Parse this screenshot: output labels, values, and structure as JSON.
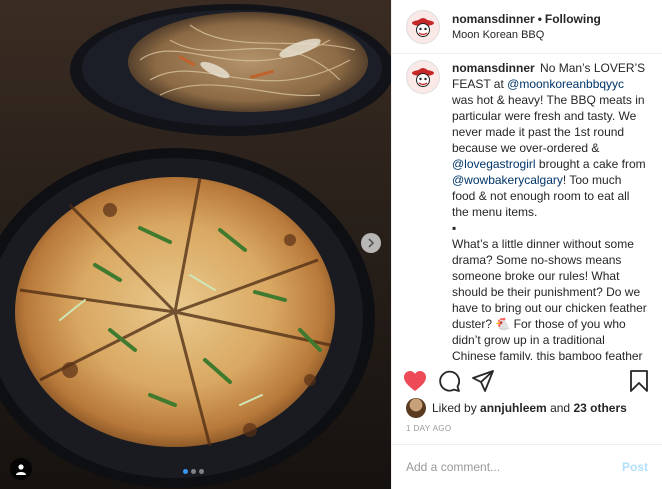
{
  "post": {
    "username": "nomansdinner",
    "separator": "•",
    "follow_status": "Following",
    "location": "Moon Korean BBQ"
  },
  "caption": {
    "username": "nomansdinner",
    "part1": "No Man’s LOVER’S FEAST at ",
    "mention1": "@moonkoreanbbqyyc",
    "part2": " was hot & heavy! The BBQ meats in particular were fresh and tasty. We never made it past the 1st round because we over-ordered & ",
    "mention2": "@lovegastrogirl",
    "part3": " brought a cake from ",
    "mention3": "@wowbakerycalgary",
    "part4": "! Too much food & not enough room to eat all the menu items.",
    "bullet": "▪",
    "paragraph2": "What’s a little dinner without some drama? Some no-shows means someone broke our rules! What should be their punishment? Do we have to bring out our chicken feather duster? 🐔 For those of you who didn’t grow up in a traditional Chinese family, this bamboo feather duster struck fear into our little souls. Whap!"
  },
  "likes": {
    "prefix": "Liked by",
    "user": "annjuhleem",
    "conjunction": "and",
    "count": "23 others"
  },
  "timestamp": "1 DAY AGO",
  "comment": {
    "placeholder": "Add a comment...",
    "post_label": "Post"
  },
  "carousel": {
    "current": 1,
    "total": 3
  },
  "colors": {
    "heart": "#ed4956",
    "link": "#003569",
    "post_disabled": "#b2dffc",
    "carousel_active": "#3897f0"
  },
  "icons": [
    "heart-icon",
    "comment-icon",
    "share-icon",
    "bookmark-icon",
    "chevron-right-icon",
    "user-tag-icon"
  ]
}
